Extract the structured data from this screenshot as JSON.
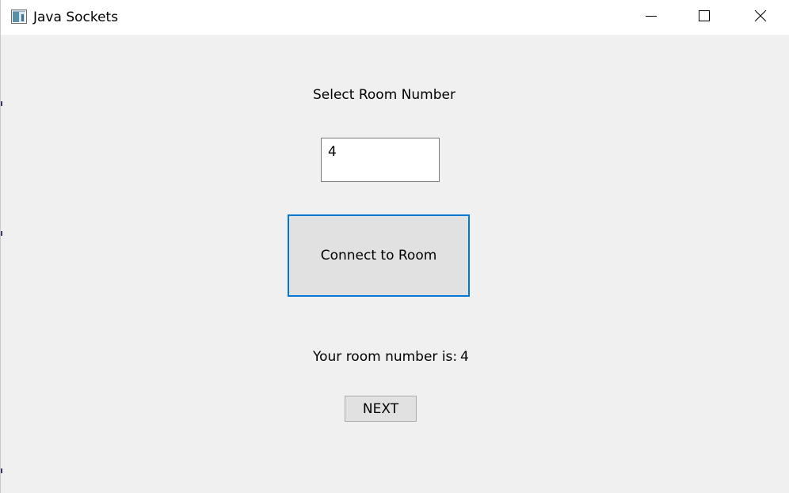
{
  "window": {
    "title": "Java Sockets"
  },
  "main": {
    "select_label": "Select Room Number",
    "room_input_value": "4",
    "connect_button_label": "Connect to Room",
    "result_label": "Your room number is:",
    "result_value": "4",
    "next_button_label": "NEXT"
  },
  "icons": {
    "app": "java-app-icon",
    "minimize": "minimize-icon",
    "maximize": "maximize-icon",
    "close": "close-icon"
  },
  "colors": {
    "focus_border": "#0078d7",
    "client_background": "#f0f0f0",
    "button_face": "#e1e1e1"
  }
}
